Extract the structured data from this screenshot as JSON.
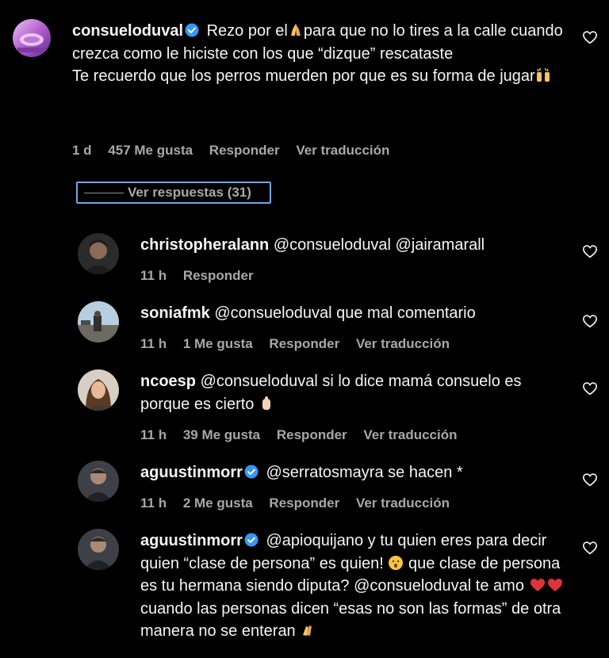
{
  "main_comment": {
    "username": "consueloduval",
    "verified": true,
    "text_1": "Rezo por el",
    "emoji_1": "praying-hands",
    "text_2": "para que no lo tires a la calle cuando crezca como le hiciste con los que “dizque” rescataste",
    "text_3": "Te recuerdo que los perros muerden por que es su forma de jugar",
    "emoji_2": "raised-hands",
    "time": "1 d",
    "likes": "457 Me gusta",
    "reply": "Responder",
    "translate": "Ver traducción"
  },
  "view_replies": {
    "label": "Ver respuestas (31)"
  },
  "replies": [
    {
      "username": "christopheralann",
      "verified": false,
      "text": "@consueloduval @jairamarall",
      "time": "11 h",
      "likes": "",
      "reply": "Responder",
      "translate": ""
    },
    {
      "username": "soniafmk",
      "verified": false,
      "text": "@consueloduval que mal comentario",
      "time": "11 h",
      "likes": "1 Me gusta",
      "reply": "Responder",
      "translate": "Ver traducción"
    },
    {
      "username": "ncoesp",
      "verified": false,
      "text": "@consueloduval si lo dice mamá consuelo es porque es cierto",
      "emoji": "hand",
      "time": "11 h",
      "likes": "39 Me gusta",
      "reply": "Responder",
      "translate": "Ver traducción"
    },
    {
      "username": "aguustinmorr",
      "verified": true,
      "text": "@serratosmayra se hacen *",
      "time": "11 h",
      "likes": "2 Me gusta",
      "reply": "Responder",
      "translate": "Ver traducción"
    },
    {
      "username": "aguustinmorr",
      "verified": true,
      "text_1": "@apioquijano y tu quien eres para decir quien “clase de persona” es quien!",
      "emoji_1": "surprised-face",
      "text_2": "que clase de persona es tu hermana siendo diputa? @consueloduval te amo",
      "emoji_2": "two-red-hearts",
      "text_3": "cuando las personas dicen “esas no son las formas” de otra manera no se enteran",
      "emoji_3": "clapping-hands"
    }
  ],
  "colors": {
    "background": "#000000",
    "text": "#f5f5f5",
    "meta": "#a8a8a8",
    "verified": "#3897f0",
    "highlight": "#6fa6e6"
  }
}
